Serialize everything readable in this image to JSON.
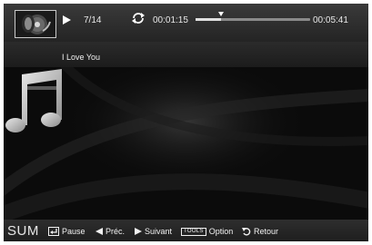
{
  "player": {
    "track_counter": "7/14",
    "elapsed": "00:01:15",
    "total": "00:05:41",
    "progress_fraction": 0.22,
    "song_title": "I Love You"
  },
  "icons": {
    "album_art": "album-art-icon",
    "play": "play-icon",
    "repeat": "repeat-icon",
    "music_note": "music-note-icon",
    "enter": "enter-icon",
    "previous": "left-arrow-icon",
    "next": "right-arrow-icon",
    "return": "return-icon"
  },
  "footer": {
    "mode": "SUM",
    "pause": "Pause",
    "previous": "Préc.",
    "next": "Suivant",
    "tools_badge": "TOOLS",
    "option": "Option",
    "return": "Retour"
  }
}
